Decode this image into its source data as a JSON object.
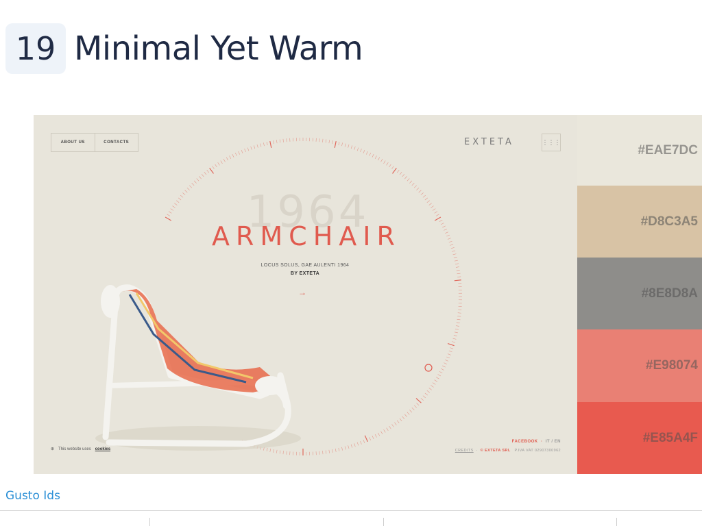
{
  "header": {
    "number": "19",
    "title": "Minimal Yet Warm"
  },
  "preview": {
    "nav": [
      "ABOUT US",
      "CONTACTS"
    ],
    "logo": "EXTETA",
    "year": "1964",
    "headline": "ARMCHAIR",
    "subtitle": "LOCUS SOLUS, GAE AULENTI 1964",
    "byline": "BY EXTETA",
    "arrow": "→",
    "cookie_text": "This website uses",
    "cookie_link": "cookies",
    "social": "FACEBOOK",
    "lang": "IT / EN",
    "credits": "CREDITS",
    "company": "© EXTETA SRL",
    "vat": "P.IVA VAT 02907300962"
  },
  "palette": [
    {
      "hex": "#EAE7DC",
      "color": "#EAE7DC"
    },
    {
      "hex": "#D8C3A5",
      "color": "#D8C3A5"
    },
    {
      "hex": "#8E8D8A",
      "color": "#8E8D8A"
    },
    {
      "hex": "#E98074",
      "color": "#E98074"
    },
    {
      "hex": "#E85A4F",
      "color": "#E85A4F"
    }
  ],
  "source": {
    "label": "Gusto Ids"
  }
}
